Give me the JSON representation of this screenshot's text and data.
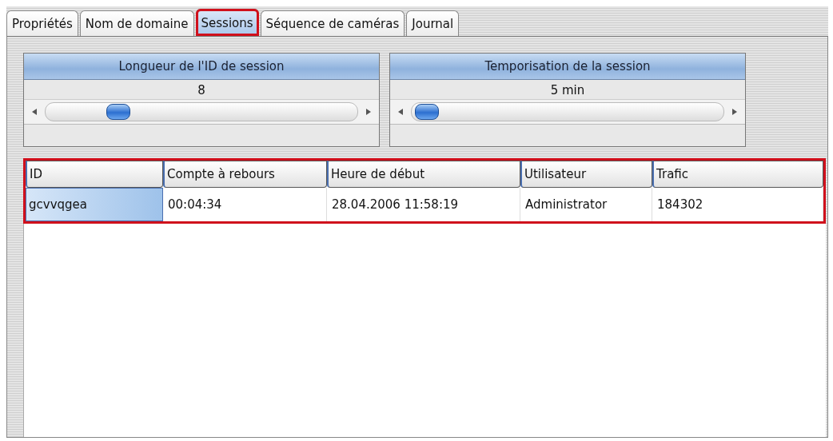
{
  "tabs": [
    {
      "label": "Propriétés",
      "selected": false,
      "highlighted": false
    },
    {
      "label": "Nom de domaine",
      "selected": false,
      "highlighted": false
    },
    {
      "label": "Sessions",
      "selected": true,
      "highlighted": true
    },
    {
      "label": "Séquence de caméras",
      "selected": false,
      "highlighted": false
    },
    {
      "label": "Journal",
      "selected": false,
      "highlighted": false
    }
  ],
  "sliders": [
    {
      "title": "Longueur de l'ID de session",
      "reading": "8",
      "level": 0.2
    },
    {
      "title": "Temporisation de la session",
      "reading": "5 min",
      "level": 0
    }
  ],
  "table": {
    "highlighted": true,
    "columns": [
      "ID",
      "Compte à rebours",
      "Heure de début",
      "Utilisateur",
      "Trafic"
    ],
    "rows": [
      {
        "selected": true,
        "cells": [
          "gcvvqgea",
          "00:04:34",
          "28.04.2006 11:58:19",
          "Administrator",
          "184302"
        ]
      }
    ]
  }
}
